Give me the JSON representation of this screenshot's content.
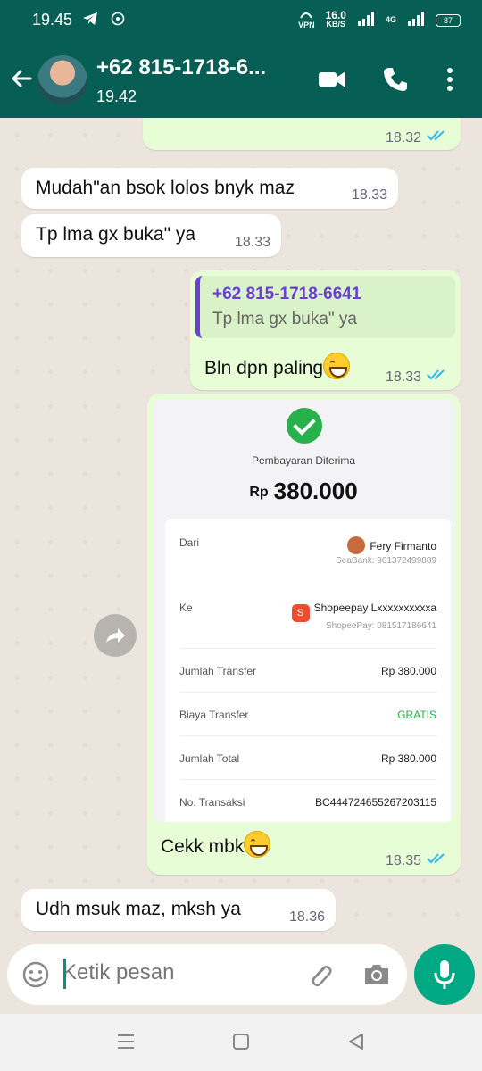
{
  "status_bar": {
    "time": "19.45",
    "net_speed": "16.0",
    "net_unit": "KB/S",
    "vpn": "VPN",
    "network": "4G",
    "battery": "87"
  },
  "header": {
    "contact": "+62 815-1718-6...",
    "last_seen": "19.42"
  },
  "messages": [
    {
      "time": "18.32"
    },
    {
      "text": "Mudah\"an bsok lolos bnyk maz",
      "time": "18.33"
    },
    {
      "text": "Tp lma gx buka\" ya",
      "time": "18.33"
    },
    {
      "quote_name": "+62 815-1718-6641",
      "quote_text": "Tp lma gx buka\" ya",
      "text": "Bln dpn paling",
      "time": "18.33"
    },
    {
      "text": "Cekk mbk",
      "time": "18.35"
    },
    {
      "text": "Udh msuk maz, mksh ya",
      "time": "18.36"
    }
  ],
  "receipt": {
    "title": "Pembayaran Diterima",
    "currency": "Rp",
    "amount": "380.000",
    "from_label": "Dari",
    "from_name": "Fery Firmanto",
    "from_bank": "SeaBank: 901372499889",
    "to_label": "Ke",
    "to_name": "Shopeepay Lxxxxxxxxxxa",
    "to_account": "ShopeePay: 081517186641",
    "rows": [
      {
        "label": "Jumlah Transfer",
        "value": "Rp 380.000"
      },
      {
        "label": "Biaya Transfer",
        "value": "GRATIS"
      },
      {
        "label": "Jumlah Total",
        "value": "Rp 380.000"
      },
      {
        "label": "No. Transaksi",
        "value": "BC444724655267203115"
      }
    ]
  },
  "composer": {
    "placeholder": "Ketik pesan"
  },
  "colors": {
    "header": "#075e54",
    "outgoing": "#e7fdd6",
    "incoming": "#ffffff",
    "read_ticks": "#34b7f1",
    "send_button": "#00a884"
  }
}
